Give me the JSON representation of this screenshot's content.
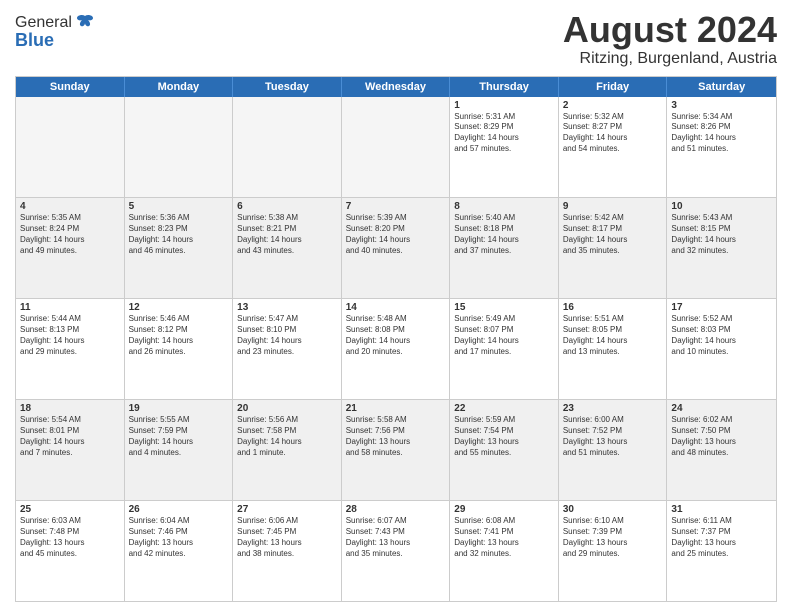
{
  "logo": {
    "general": "General",
    "blue": "Blue"
  },
  "title": "August 2024",
  "location": "Ritzing, Burgenland, Austria",
  "days_of_week": [
    "Sunday",
    "Monday",
    "Tuesday",
    "Wednesday",
    "Thursday",
    "Friday",
    "Saturday"
  ],
  "weeks": [
    [
      {
        "day": "",
        "info": ""
      },
      {
        "day": "",
        "info": ""
      },
      {
        "day": "",
        "info": ""
      },
      {
        "day": "",
        "info": ""
      },
      {
        "day": "1",
        "info": "Sunrise: 5:31 AM\nSunset: 8:29 PM\nDaylight: 14 hours\nand 57 minutes."
      },
      {
        "day": "2",
        "info": "Sunrise: 5:32 AM\nSunset: 8:27 PM\nDaylight: 14 hours\nand 54 minutes."
      },
      {
        "day": "3",
        "info": "Sunrise: 5:34 AM\nSunset: 8:26 PM\nDaylight: 14 hours\nand 51 minutes."
      }
    ],
    [
      {
        "day": "4",
        "info": "Sunrise: 5:35 AM\nSunset: 8:24 PM\nDaylight: 14 hours\nand 49 minutes."
      },
      {
        "day": "5",
        "info": "Sunrise: 5:36 AM\nSunset: 8:23 PM\nDaylight: 14 hours\nand 46 minutes."
      },
      {
        "day": "6",
        "info": "Sunrise: 5:38 AM\nSunset: 8:21 PM\nDaylight: 14 hours\nand 43 minutes."
      },
      {
        "day": "7",
        "info": "Sunrise: 5:39 AM\nSunset: 8:20 PM\nDaylight: 14 hours\nand 40 minutes."
      },
      {
        "day": "8",
        "info": "Sunrise: 5:40 AM\nSunset: 8:18 PM\nDaylight: 14 hours\nand 37 minutes."
      },
      {
        "day": "9",
        "info": "Sunrise: 5:42 AM\nSunset: 8:17 PM\nDaylight: 14 hours\nand 35 minutes."
      },
      {
        "day": "10",
        "info": "Sunrise: 5:43 AM\nSunset: 8:15 PM\nDaylight: 14 hours\nand 32 minutes."
      }
    ],
    [
      {
        "day": "11",
        "info": "Sunrise: 5:44 AM\nSunset: 8:13 PM\nDaylight: 14 hours\nand 29 minutes."
      },
      {
        "day": "12",
        "info": "Sunrise: 5:46 AM\nSunset: 8:12 PM\nDaylight: 14 hours\nand 26 minutes."
      },
      {
        "day": "13",
        "info": "Sunrise: 5:47 AM\nSunset: 8:10 PM\nDaylight: 14 hours\nand 23 minutes."
      },
      {
        "day": "14",
        "info": "Sunrise: 5:48 AM\nSunset: 8:08 PM\nDaylight: 14 hours\nand 20 minutes."
      },
      {
        "day": "15",
        "info": "Sunrise: 5:49 AM\nSunset: 8:07 PM\nDaylight: 14 hours\nand 17 minutes."
      },
      {
        "day": "16",
        "info": "Sunrise: 5:51 AM\nSunset: 8:05 PM\nDaylight: 14 hours\nand 13 minutes."
      },
      {
        "day": "17",
        "info": "Sunrise: 5:52 AM\nSunset: 8:03 PM\nDaylight: 14 hours\nand 10 minutes."
      }
    ],
    [
      {
        "day": "18",
        "info": "Sunrise: 5:54 AM\nSunset: 8:01 PM\nDaylight: 14 hours\nand 7 minutes."
      },
      {
        "day": "19",
        "info": "Sunrise: 5:55 AM\nSunset: 7:59 PM\nDaylight: 14 hours\nand 4 minutes."
      },
      {
        "day": "20",
        "info": "Sunrise: 5:56 AM\nSunset: 7:58 PM\nDaylight: 14 hours\nand 1 minute."
      },
      {
        "day": "21",
        "info": "Sunrise: 5:58 AM\nSunset: 7:56 PM\nDaylight: 13 hours\nand 58 minutes."
      },
      {
        "day": "22",
        "info": "Sunrise: 5:59 AM\nSunset: 7:54 PM\nDaylight: 13 hours\nand 55 minutes."
      },
      {
        "day": "23",
        "info": "Sunrise: 6:00 AM\nSunset: 7:52 PM\nDaylight: 13 hours\nand 51 minutes."
      },
      {
        "day": "24",
        "info": "Sunrise: 6:02 AM\nSunset: 7:50 PM\nDaylight: 13 hours\nand 48 minutes."
      }
    ],
    [
      {
        "day": "25",
        "info": "Sunrise: 6:03 AM\nSunset: 7:48 PM\nDaylight: 13 hours\nand 45 minutes."
      },
      {
        "day": "26",
        "info": "Sunrise: 6:04 AM\nSunset: 7:46 PM\nDaylight: 13 hours\nand 42 minutes."
      },
      {
        "day": "27",
        "info": "Sunrise: 6:06 AM\nSunset: 7:45 PM\nDaylight: 13 hours\nand 38 minutes."
      },
      {
        "day": "28",
        "info": "Sunrise: 6:07 AM\nSunset: 7:43 PM\nDaylight: 13 hours\nand 35 minutes."
      },
      {
        "day": "29",
        "info": "Sunrise: 6:08 AM\nSunset: 7:41 PM\nDaylight: 13 hours\nand 32 minutes."
      },
      {
        "day": "30",
        "info": "Sunrise: 6:10 AM\nSunset: 7:39 PM\nDaylight: 13 hours\nand 29 minutes."
      },
      {
        "day": "31",
        "info": "Sunrise: 6:11 AM\nSunset: 7:37 PM\nDaylight: 13 hours\nand 25 minutes."
      }
    ]
  ]
}
